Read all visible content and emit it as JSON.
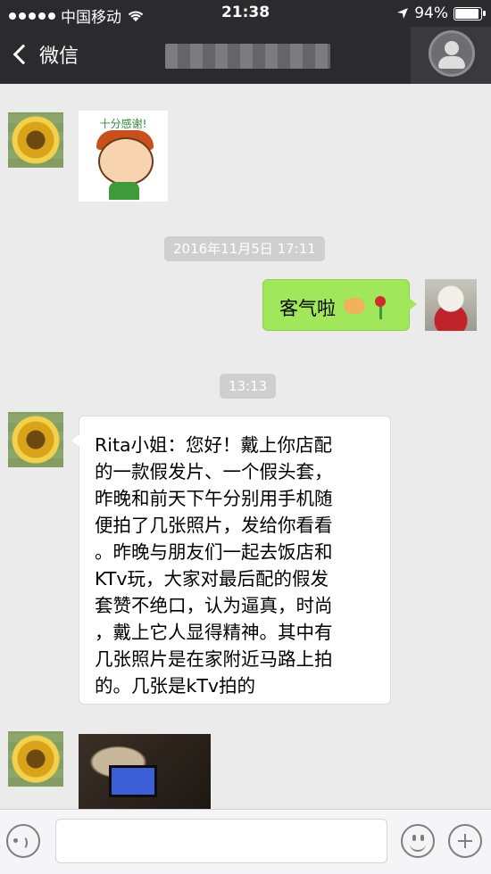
{
  "status_bar": {
    "carrier": "中国移动",
    "time": "21:38",
    "battery": "94%",
    "battery_level": 0.94,
    "icons": [
      "signal-dots-icon",
      "wifi-icon",
      "location-arrow-icon",
      "battery-icon"
    ]
  },
  "nav": {
    "back_label": "微信",
    "title": "",
    "icons": [
      "chevron-left-icon",
      "contact-profile-icon"
    ]
  },
  "messages": [
    {
      "type": "sticker",
      "side": "left",
      "sticker_text": "十分感谢!"
    },
    {
      "type": "timestamp",
      "text": "2016年11月5日 17:11"
    },
    {
      "type": "text",
      "side": "right",
      "text": "客气啦",
      "emoji": [
        "handshake-emoji",
        "rose-emoji"
      ]
    },
    {
      "type": "timestamp",
      "text": "13:13"
    },
    {
      "type": "text",
      "side": "left",
      "text": "Rita小姐：您好！戴上你店配\n的一款假发片、一个假头套，\n昨晚和前天下午分别用手机随\n便拍了几张照片，发给你看看\n。昨晚与朋友们一起去饭店和\nKTv玩，大家对最后配的假发\n套赞不绝口，认为逼真，时尚\n，戴上它人显得精神。其中有\n几张照片是在家附近马路上拍\n的。几张是kTv拍的"
    },
    {
      "type": "image",
      "side": "left"
    }
  ],
  "input_bar": {
    "icons": [
      "voice-icon",
      "emoji-icon",
      "plus-icon"
    ]
  },
  "colors": {
    "nav_bg": "#2b2b2f",
    "chat_bg": "#ebebeb",
    "bubble_self": "#a0e75a",
    "bubble_other": "#ffffff"
  }
}
